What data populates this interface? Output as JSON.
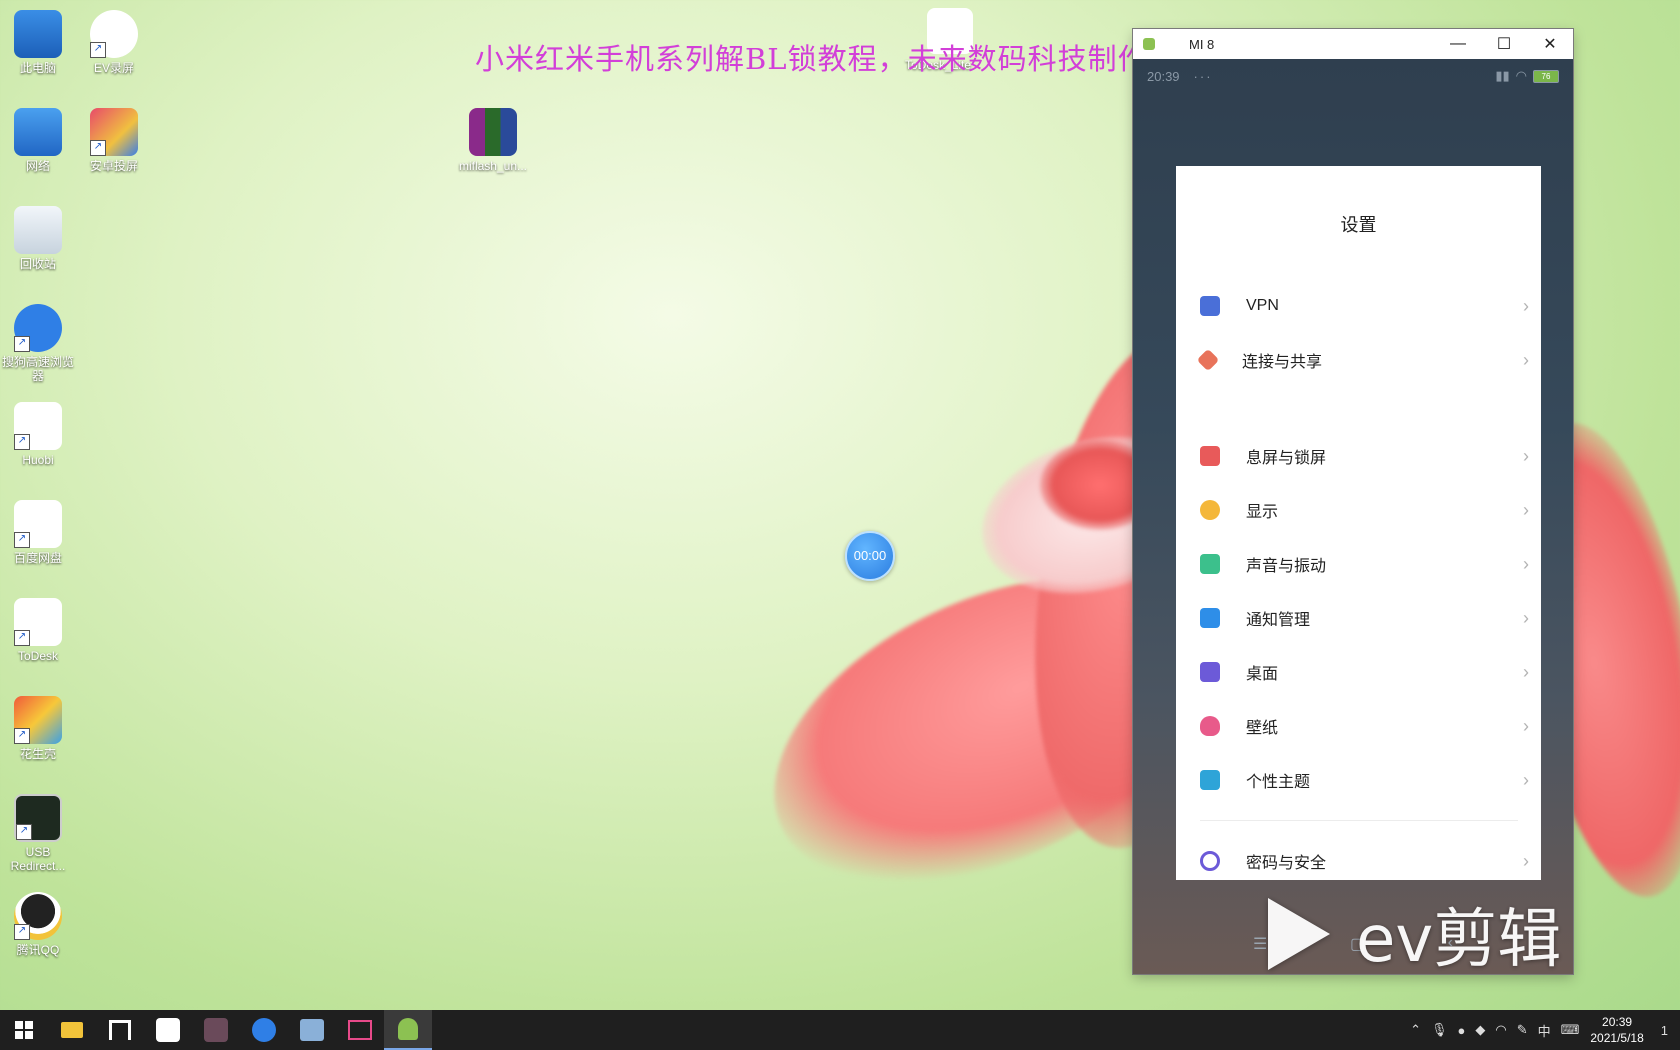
{
  "overlay_title": "小米红米手机系列解BL锁教程，未来数码科技制作",
  "desktop_icons": [
    {
      "label": "此电脑"
    },
    {
      "label": "EV录屏"
    },
    {
      "label": "网络"
    },
    {
      "label": "安卓投屏"
    },
    {
      "label": "回收站"
    },
    {
      "label": "搜狗高速浏览器"
    },
    {
      "label": "Huobi"
    },
    {
      "label": "百度网盘"
    },
    {
      "label": "ToDesk"
    },
    {
      "label": "花生壳"
    },
    {
      "label": "USB Redirect..."
    },
    {
      "label": "腾讯QQ"
    },
    {
      "label": "miflash_un..."
    },
    {
      "label": "ToDesk_Lite"
    }
  ],
  "timer": "00:00",
  "window": {
    "title": "MI 8",
    "minimize": "—",
    "maximize": "☐",
    "close": "✕"
  },
  "phone": {
    "status_time": "20:39",
    "status_more": "···",
    "battery": "76",
    "settings_title": "设置",
    "items": [
      {
        "label": "VPN",
        "color": "#4a6fd8"
      },
      {
        "label": "连接与共享",
        "color": "#e8735a"
      },
      {
        "label": "息屏与锁屏",
        "color": "#e85a5a"
      },
      {
        "label": "显示",
        "color": "#f4b73a"
      },
      {
        "label": "声音与振动",
        "color": "#3cc08c"
      },
      {
        "label": "通知管理",
        "color": "#2e8ee8"
      },
      {
        "label": "桌面",
        "color": "#6c5ad8"
      },
      {
        "label": "壁纸",
        "color": "#e85a8a"
      },
      {
        "label": "个性主题",
        "color": "#2ea4d8"
      },
      {
        "label": "密码与安全",
        "color": "#6c5ad8"
      }
    ],
    "chevron": "›"
  },
  "watermark": "ev剪辑",
  "taskbar": {
    "clock_time": "20:39",
    "clock_date": "2021/5/18",
    "ime": "中",
    "notification_count": "1"
  }
}
